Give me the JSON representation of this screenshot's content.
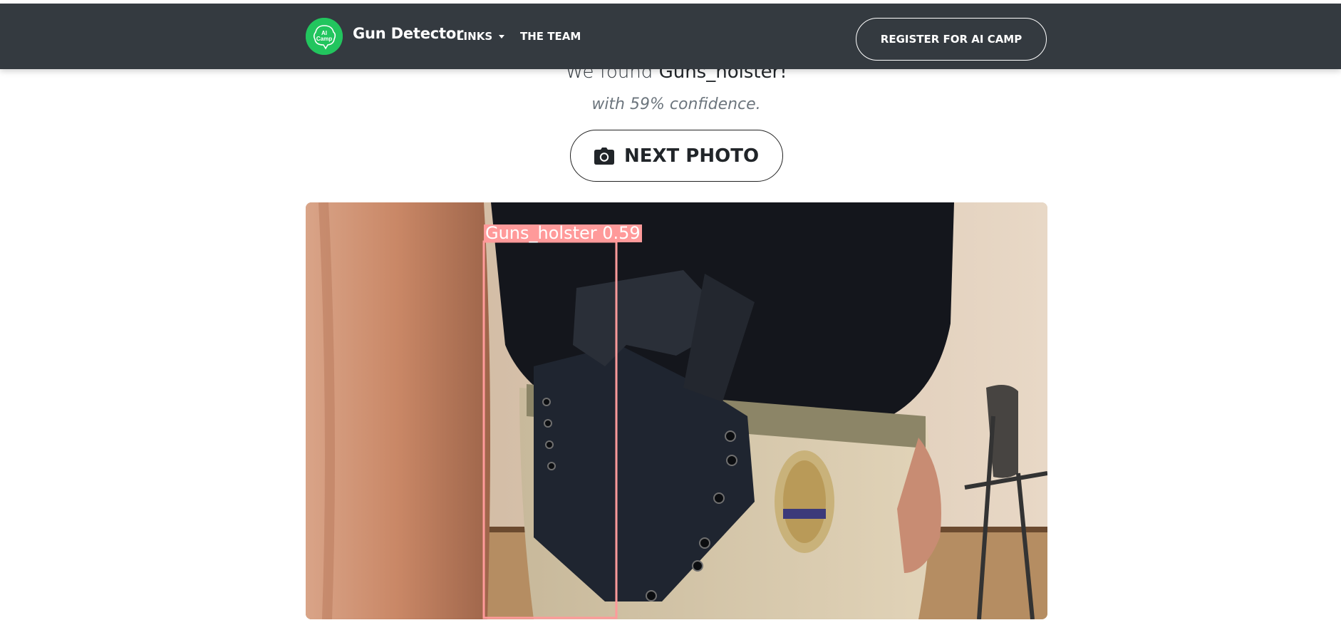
{
  "navbar": {
    "brand_logo_text": "AI Camp",
    "brand_name": "Gun Detector",
    "links_label": "LINKS",
    "team_label": "THE TEAM",
    "register_label": "REGISTER FOR AI CAMP"
  },
  "result": {
    "found_prefix": "We found ",
    "found_class": "Guns_holster!",
    "confidence_text": "with 59% confidence.",
    "next_button_label": "NEXT PHOTO"
  },
  "detection": {
    "label": "Guns_holster 0.59",
    "box_color": "#ff9a9a"
  },
  "colors": {
    "navbar_bg": "#343a40",
    "brand_green": "#22c55e"
  }
}
